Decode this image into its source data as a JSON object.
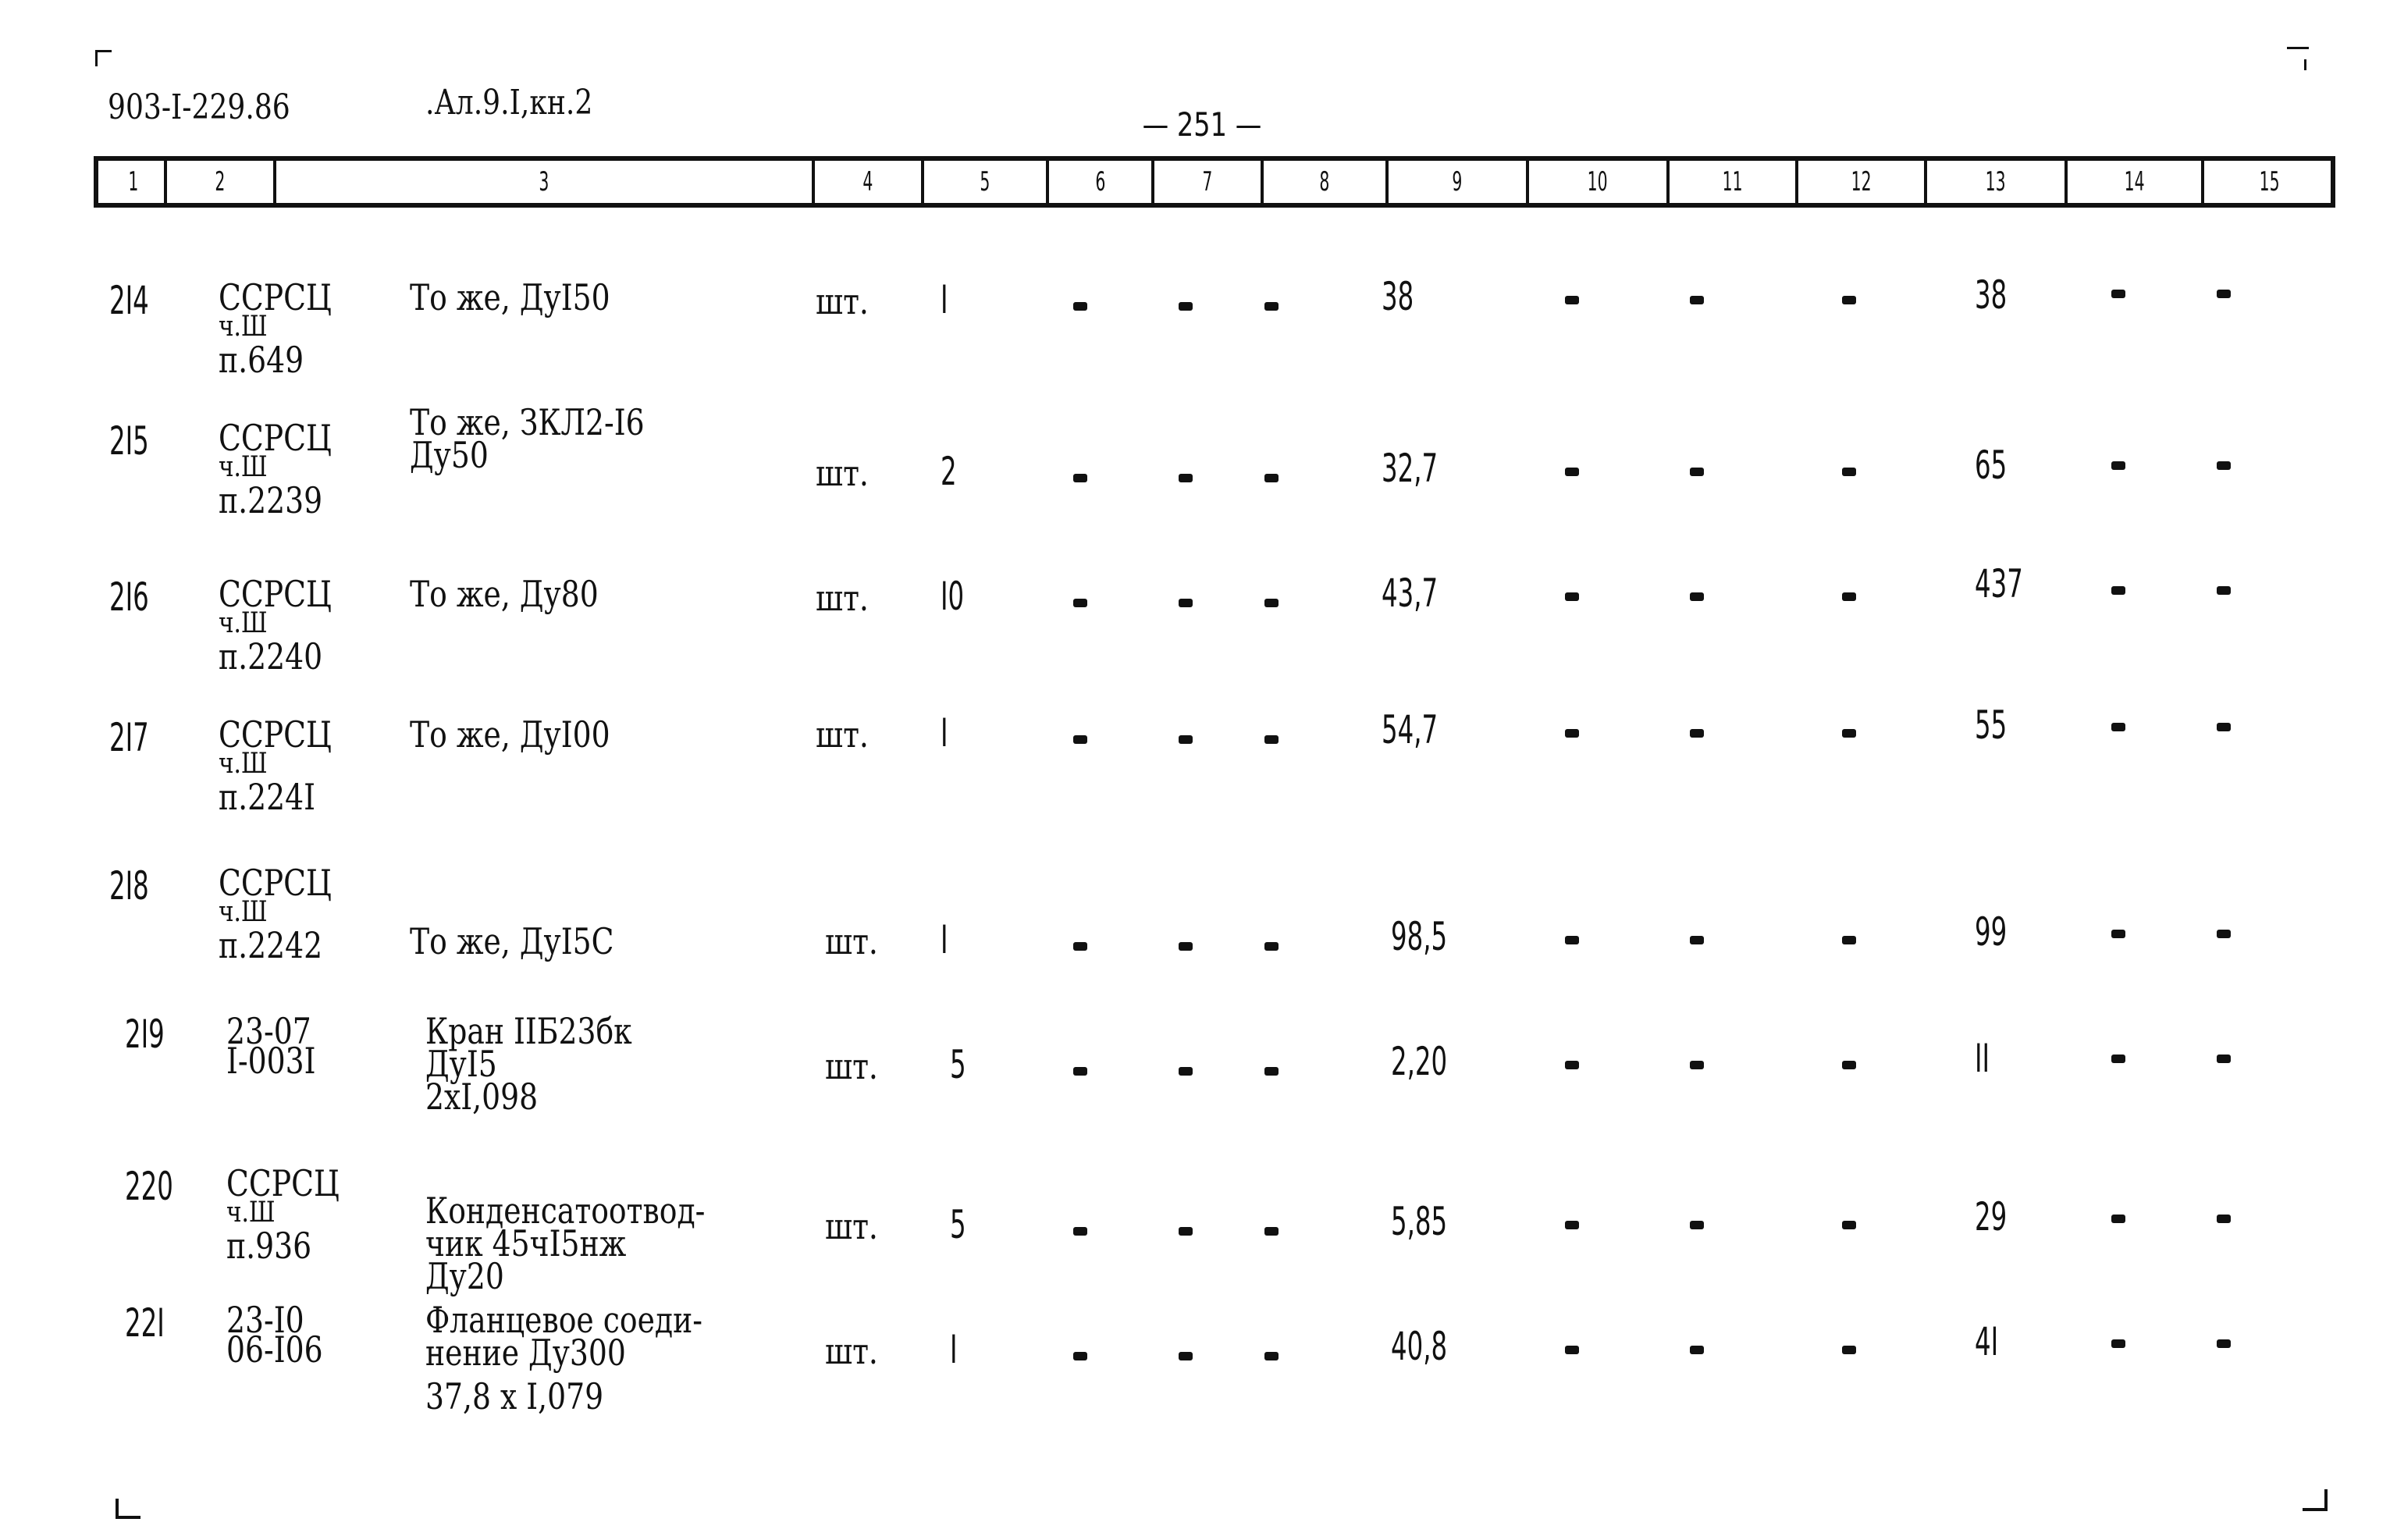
{
  "header": {
    "doc_code": "903-I-229.86",
    "album_ref": ".Ал.9.I,кн.2",
    "page_number": "— 251 —"
  },
  "column_headers": [
    "1",
    "2",
    "3",
    "4",
    "5",
    "6",
    "7",
    "8",
    "9",
    "10",
    "11",
    "12",
    "13",
    "14",
    "15"
  ],
  "rows": [
    {
      "no": "2I4",
      "ref": [
        "ССРСЦ",
        "ч.Ш",
        "п.649"
      ],
      "name": [
        "То же, ДуI50"
      ],
      "unit": "шт.",
      "qty": "I",
      "c6": "-",
      "c7": "-",
      "c8": "-",
      "c9": "38",
      "c10": "-",
      "c11": "-",
      "c12": "-",
      "c13": "38",
      "c14": "-",
      "c15": "-"
    },
    {
      "no": "2I5",
      "ref": [
        "ССРСЦ",
        "ч.Ш",
        "п.2239"
      ],
      "name": [
        "То же, ЗКЛ2-I6",
        "Ду50"
      ],
      "unit": "шт.",
      "qty": "2",
      "c6": "-",
      "c7": "-",
      "c8": "-",
      "c9": "32,7",
      "c10": "-",
      "c11": "-",
      "c12": "-",
      "c13": "65",
      "c14": "-",
      "c15": "-"
    },
    {
      "no": "2I6",
      "ref": [
        "ССРСЦ",
        "ч.Ш",
        "п.2240"
      ],
      "name": [
        "То же, Ду80"
      ],
      "unit": "шт.",
      "qty": "I0",
      "c6": "-",
      "c7": "-",
      "c8": "-",
      "c9": "43,7",
      "c10": "-",
      "c11": "-",
      "c12": "-",
      "c13": "437",
      "c14": "-",
      "c15": "-"
    },
    {
      "no": "2I7",
      "ref": [
        "ССРСЦ",
        "ч.Ш",
        "п.224I"
      ],
      "name": [
        "То же, ДуI00"
      ],
      "unit": "шт.",
      "qty": "I",
      "c6": "-",
      "c7": "-",
      "c8": "-",
      "c9": "54,7",
      "c10": "-",
      "c11": "-",
      "c12": "-",
      "c13": "55",
      "c14": "-",
      "c15": "-"
    },
    {
      "no": "2I8",
      "ref": [
        "ССРСЦ",
        "ч.Ш",
        "п.2242"
      ],
      "name": [
        "То же, ДуI5С"
      ],
      "unit": "шт.",
      "qty": "I",
      "c6": "-",
      "c7": "-",
      "c8": "-",
      "c9": "98,5",
      "c10": "-",
      "c11": "-",
      "c12": "-",
      "c13": "99",
      "c14": "-",
      "c15": "-"
    },
    {
      "no": "2I9",
      "ref": [
        "23-07",
        "I-003I"
      ],
      "name": [
        "Кран IIБ23бк",
        "ДуI5",
        "2хI,098"
      ],
      "unit": "шт.",
      "qty": "5",
      "c6": "-",
      "c7": "-",
      "c8": "-",
      "c9": "2,20",
      "c10": "-",
      "c11": "-",
      "c12": "-",
      "c13": "II",
      "c14": "-",
      "c15": "-"
    },
    {
      "no": "220",
      "ref": [
        "ССРСЦ",
        "ч.Ш",
        "п.936"
      ],
      "name": [
        "Конденсатоотвод-",
        "чик 45чI5нж",
        "Ду20"
      ],
      "unit": "шт.",
      "qty": "5",
      "c6": "-",
      "c7": "-",
      "c8": "-",
      "c9": "5,85",
      "c10": "-",
      "c11": "-",
      "c12": "-",
      "c13": "29",
      "c14": "-",
      "c15": "-"
    },
    {
      "no": "22I",
      "ref": [
        "23-I0",
        "06-I06"
      ],
      "name": [
        "Фланцевое соеди-",
        "нение Ду300",
        "37,8 х I,079"
      ],
      "unit": "шт.",
      "qty": "I",
      "c6": "-",
      "c7": "-",
      "c8": "-",
      "c9": "40,8",
      "c10": "-",
      "c11": "-",
      "c12": "-",
      "c13": "4I",
      "c14": "-",
      "c15": "-"
    }
  ]
}
